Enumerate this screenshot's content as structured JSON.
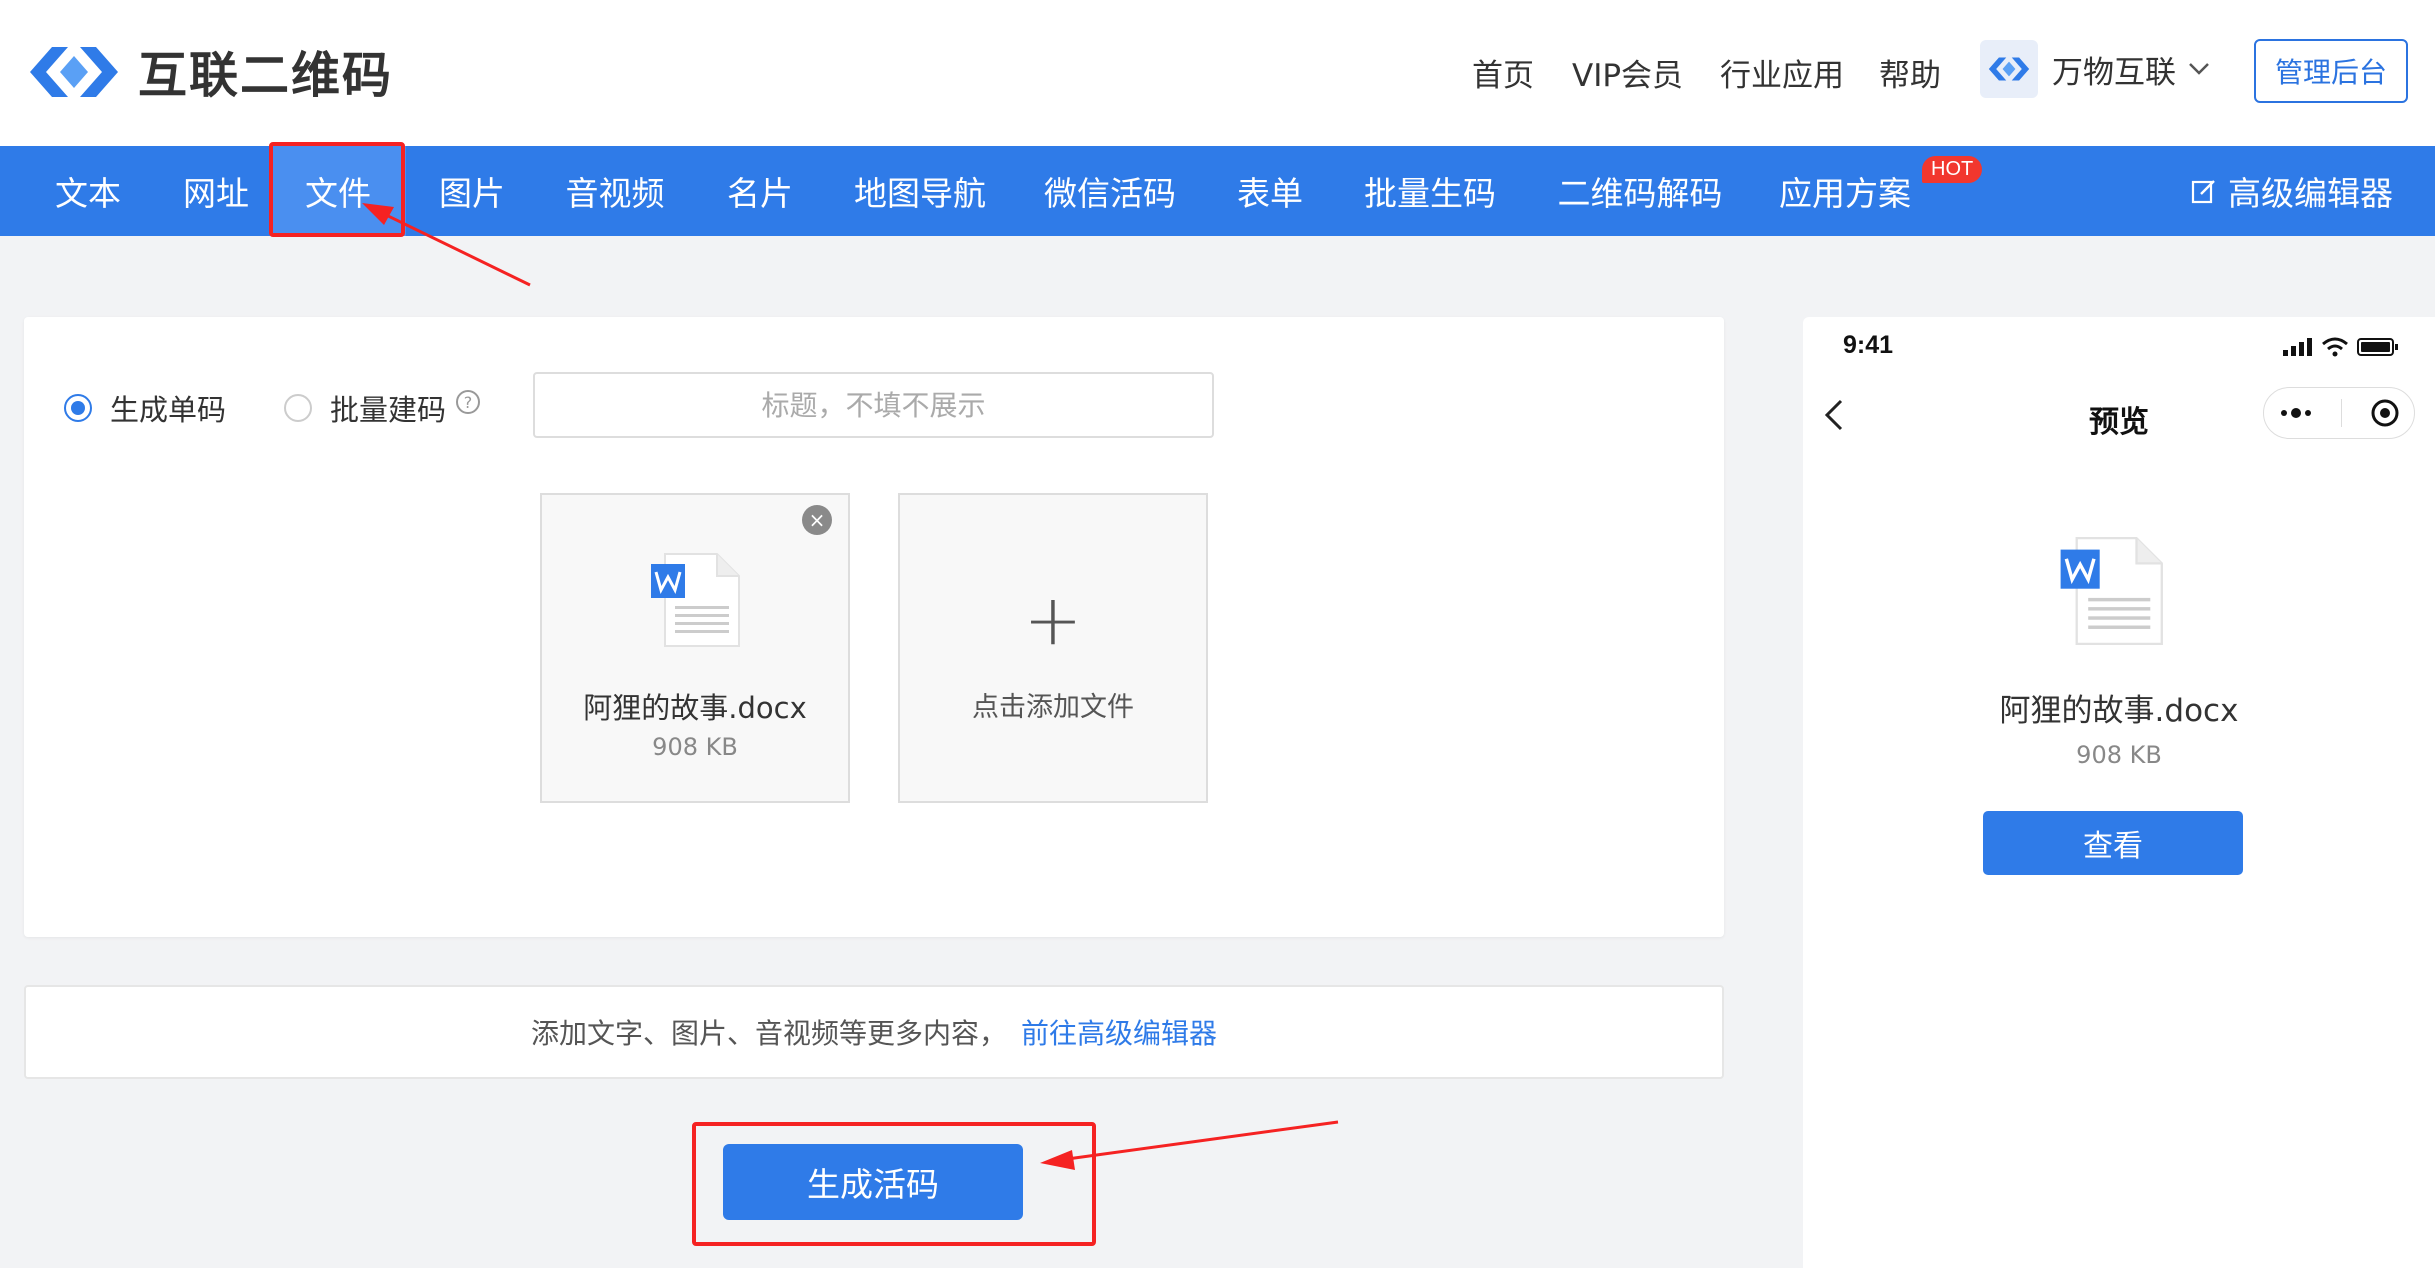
{
  "header": {
    "logo_text": "互联二维码",
    "nav": [
      "首页",
      "VIP会员",
      "行业应用",
      "帮助"
    ],
    "org_name": "万物互联",
    "admin_label": "管理后台"
  },
  "tabs": [
    "文本",
    "网址",
    "文件",
    "图片",
    "音视频",
    "名片",
    "地图导航",
    "微信活码",
    "表单",
    "批量生码",
    "二维码解码",
    "应用方案"
  ],
  "active_tab": "文件",
  "hot_badge": "HOT",
  "advanced_editor": "高级编辑器",
  "form": {
    "mode_single": "生成单码",
    "mode_batch": "批量建码",
    "help": "?",
    "title_placeholder": "标题，不填不展示"
  },
  "file": {
    "name": "阿狸的故事.docx",
    "size": "908 KB",
    "close": "×"
  },
  "add_file": {
    "plus": "+",
    "label": "点击添加文件"
  },
  "tip": {
    "text": "添加文字、图片、音视频等更多内容，",
    "link": "前往高级编辑器"
  },
  "generate_label": "生成活码",
  "preview": {
    "time": "9:41",
    "title": "预览",
    "file_name": "阿狸的故事.docx",
    "file_size": "908 KB",
    "view_label": "查看"
  },
  "colors": {
    "primary": "#2f7be8",
    "annotation_red": "#f52222",
    "hot_red": "#f2372e"
  }
}
